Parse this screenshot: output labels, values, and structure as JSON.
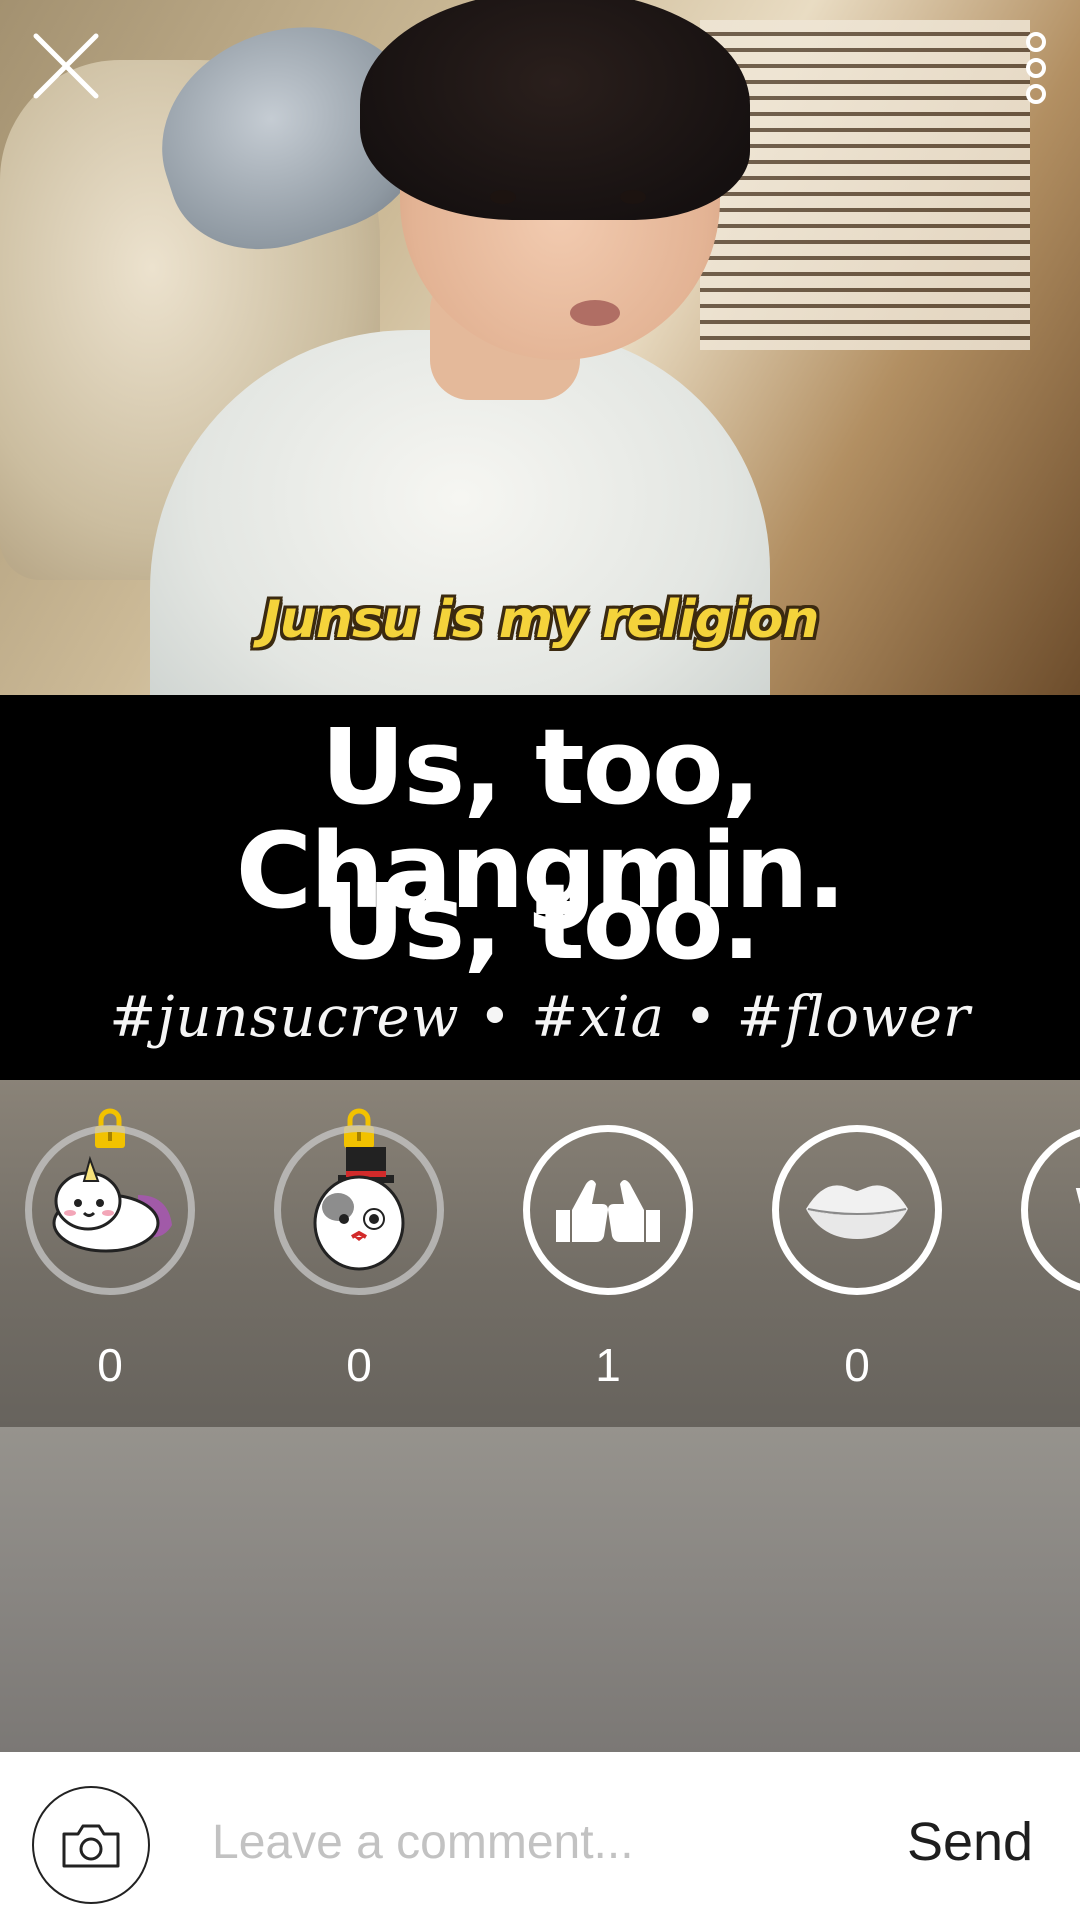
{
  "media": {
    "caption": "Junsu is my religion"
  },
  "banner": {
    "line1": "Us, too, Changmin.",
    "line2": "Us, too.",
    "tags": "#junsucrew • #xia • #flower"
  },
  "reactions": [
    {
      "name": "unicorn-dog-sticker",
      "count": "0",
      "locked": true
    },
    {
      "name": "top-hat-cat-sticker",
      "count": "0",
      "locked": true
    },
    {
      "name": "thumbs-up",
      "count": "1",
      "locked": false
    },
    {
      "name": "lips",
      "count": "0",
      "locked": false
    },
    {
      "name": "partial-w",
      "glyph": "W"
    }
  ],
  "comment": {
    "placeholder": "Leave a comment...",
    "send_label": "Send"
  },
  "icons": {
    "close": "close-icon",
    "more": "more-vertical-icon",
    "camera": "camera-icon",
    "lock": "lock-icon"
  },
  "colors": {
    "lock": "#f2c200",
    "caption": "#f4d33b",
    "banner_bg": "#000000"
  }
}
